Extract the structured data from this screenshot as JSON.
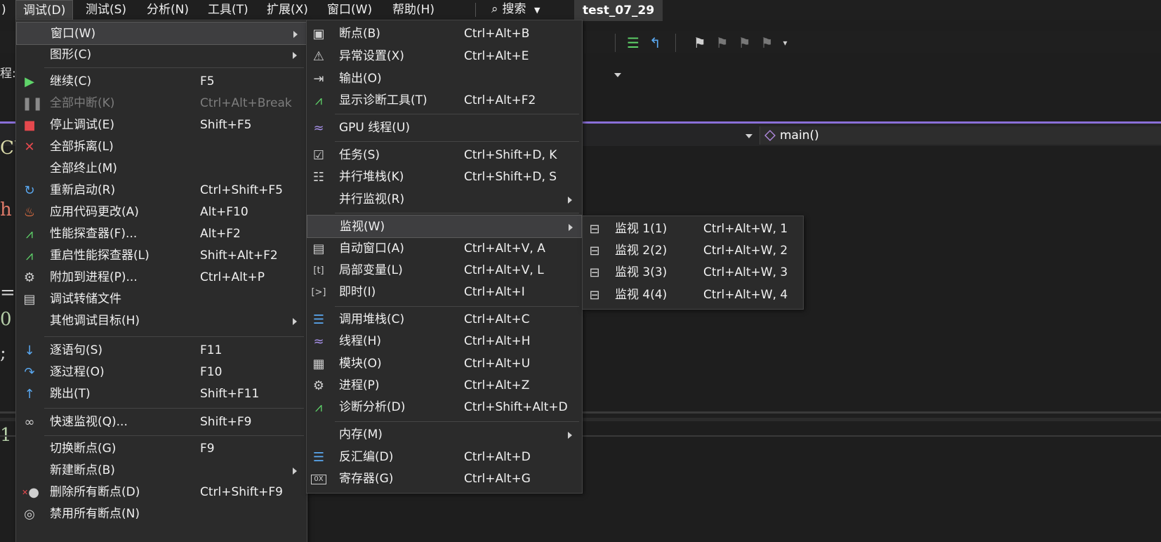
{
  "menubar": {
    "items": [
      {
        "label": "调试(D)"
      },
      {
        "label": "测试(S)"
      },
      {
        "label": "分析(N)"
      },
      {
        "label": "工具(T)"
      },
      {
        "label": "扩展(X)"
      },
      {
        "label": "窗口(W)"
      },
      {
        "label": "帮助(H)"
      }
    ],
    "search_label": "搜索",
    "solution_name": "test_07_29"
  },
  "background": {
    "process_label": "程:",
    "function_name": "main()",
    "code_fragments": [
      "CU",
      "h",
      "=",
      "0",
      ";",
      "1"
    ]
  },
  "colors": {
    "accent_purple": "#8a6fd8",
    "menu_bg": "#2b2b2b",
    "highlight_bg": "#3e3e40"
  },
  "debug_menu": {
    "items": [
      {
        "label": "窗口(W)",
        "shortcut": ""
      },
      {
        "label": "图形(C)",
        "shortcut": ""
      },
      {
        "label": "继续(C)",
        "shortcut": "F5"
      },
      {
        "label": "全部中断(K)",
        "shortcut": "Ctrl+Alt+Break"
      },
      {
        "label": "停止调试(E)",
        "shortcut": "Shift+F5"
      },
      {
        "label": "全部拆离(L)",
        "shortcut": ""
      },
      {
        "label": "全部终止(M)",
        "shortcut": ""
      },
      {
        "label": "重新启动(R)",
        "shortcut": "Ctrl+Shift+F5"
      },
      {
        "label": "应用代码更改(A)",
        "shortcut": "Alt+F10"
      },
      {
        "label": "性能探查器(F)...",
        "shortcut": "Alt+F2"
      },
      {
        "label": "重启性能探查器(L)",
        "shortcut": "Shift+Alt+F2"
      },
      {
        "label": "附加到进程(P)...",
        "shortcut": "Ctrl+Alt+P"
      },
      {
        "label": "调试转储文件",
        "shortcut": ""
      },
      {
        "label": "其他调试目标(H)",
        "shortcut": ""
      },
      {
        "label": "逐语句(S)",
        "shortcut": "F11"
      },
      {
        "label": "逐过程(O)",
        "shortcut": "F10"
      },
      {
        "label": "跳出(T)",
        "shortcut": "Shift+F11"
      },
      {
        "label": "快速监视(Q)...",
        "shortcut": "Shift+F9"
      },
      {
        "label": "切换断点(G)",
        "shortcut": "F9"
      },
      {
        "label": "新建断点(B)",
        "shortcut": ""
      },
      {
        "label": "删除所有断点(D)",
        "shortcut": "Ctrl+Shift+F9"
      },
      {
        "label": "禁用所有断点(N)",
        "shortcut": ""
      }
    ]
  },
  "window_menu": {
    "items": [
      {
        "label": "断点(B)",
        "shortcut": "Ctrl+Alt+B"
      },
      {
        "label": "异常设置(X)",
        "shortcut": "Ctrl+Alt+E"
      },
      {
        "label": "输出(O)",
        "shortcut": ""
      },
      {
        "label": "显示诊断工具(T)",
        "shortcut": "Ctrl+Alt+F2"
      },
      {
        "label": "GPU 线程(U)",
        "shortcut": ""
      },
      {
        "label": "任务(S)",
        "shortcut": "Ctrl+Shift+D, K"
      },
      {
        "label": "并行堆栈(K)",
        "shortcut": "Ctrl+Shift+D, S"
      },
      {
        "label": "并行监视(R)",
        "shortcut": ""
      },
      {
        "label": "监视(W)",
        "shortcut": ""
      },
      {
        "label": "自动窗口(A)",
        "shortcut": "Ctrl+Alt+V, A"
      },
      {
        "label": "局部变量(L)",
        "shortcut": "Ctrl+Alt+V, L"
      },
      {
        "label": "即时(I)",
        "shortcut": "Ctrl+Alt+I"
      },
      {
        "label": "调用堆栈(C)",
        "shortcut": "Ctrl+Alt+C"
      },
      {
        "label": "线程(H)",
        "shortcut": "Ctrl+Alt+H"
      },
      {
        "label": "模块(O)",
        "shortcut": "Ctrl+Alt+U"
      },
      {
        "label": "进程(P)",
        "shortcut": "Ctrl+Alt+Z"
      },
      {
        "label": "诊断分析(D)",
        "shortcut": "Ctrl+Shift+Alt+D"
      },
      {
        "label": "内存(M)",
        "shortcut": ""
      },
      {
        "label": "反汇编(D)",
        "shortcut": "Ctrl+Alt+D"
      },
      {
        "label": "寄存器(G)",
        "shortcut": "Ctrl+Alt+G"
      }
    ]
  },
  "watch_menu": {
    "items": [
      {
        "label": "监视 1(1)",
        "shortcut": "Ctrl+Alt+W, 1"
      },
      {
        "label": "监视 2(2)",
        "shortcut": "Ctrl+Alt+W, 2"
      },
      {
        "label": "监视 3(3)",
        "shortcut": "Ctrl+Alt+W, 3"
      },
      {
        "label": "监视 4(4)",
        "shortcut": "Ctrl+Alt+W, 4"
      }
    ]
  }
}
